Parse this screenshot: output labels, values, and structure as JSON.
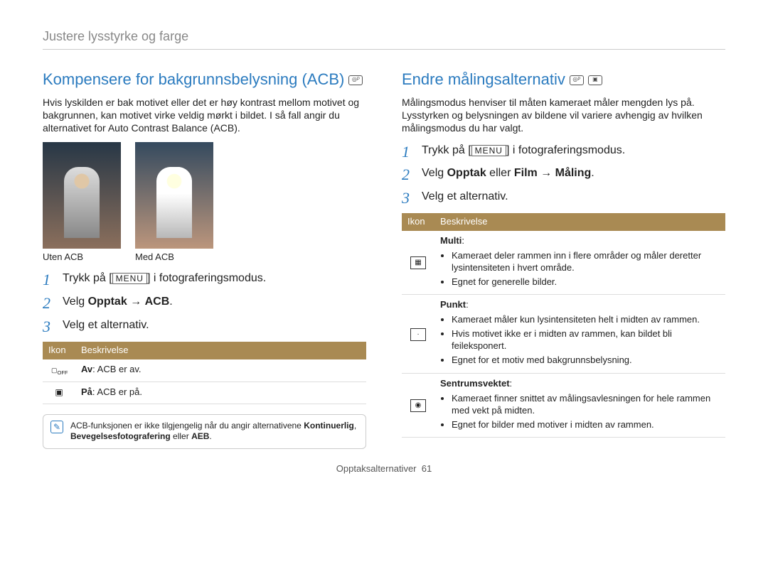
{
  "breadcrumb": "Justere lysstyrke og farge",
  "left": {
    "title": "Kompensere for bakgrunnsbelysning (ACB)",
    "mode_icons": [
      "camera-p"
    ],
    "intro": "Hvis lyskilden er bak motivet eller det er høy kontrast mellom motivet og bakgrunnen, kan motivet virke veldig mørkt i bildet. I så fall angir du alternativet for Auto Contrast Balance (ACB).",
    "captions": {
      "without": "Uten ACB",
      "with": "Med ACB"
    },
    "steps": {
      "s1_pre": "Trykk på [",
      "s1_btn": "MENU",
      "s1_post": "] i fotograferingsmodus.",
      "s2_pre": "Velg ",
      "s2_b1": "Opptak",
      "s2_arrow": " → ",
      "s2_b2": "ACB",
      "s2_post": ".",
      "s3": "Velg et alternativ."
    },
    "table": {
      "h1": "Ikon",
      "h2": "Beskrivelse",
      "rows": [
        {
          "icon": "acb-off",
          "label_b": "Av",
          "label_rest": ": ACB er av."
        },
        {
          "icon": "acb-on",
          "label_b": "På",
          "label_rest": ": ACB er på."
        }
      ]
    },
    "note": {
      "pre": "ACB-funksjonen er ikke tilgjengelig når du angir alternativene ",
      "b1": "Kontinuerlig",
      "mid": ", ",
      "b2": "Bevegelsesfotografering",
      "mid2": " eller ",
      "b3": "AEB",
      "post": "."
    }
  },
  "right": {
    "title": "Endre målingsalternativ",
    "mode_icons": [
      "camera-p",
      "video"
    ],
    "intro": "Målingsmodus henviser til måten kameraet måler mengden lys på. Lysstyrken og belysningen av bildene vil variere avhengig av hvilken målingsmodus du har valgt.",
    "steps": {
      "s1_pre": "Trykk på [",
      "s1_btn": "MENU",
      "s1_post": "] i fotograferingsmodus.",
      "s2_pre": "Velg ",
      "s2_b1": "Opptak",
      "s2_mid": " eller ",
      "s2_b2": "Film",
      "s2_arrow": " → ",
      "s2_b3": "Måling",
      "s2_post": ".",
      "s3": "Velg et alternativ."
    },
    "table": {
      "h1": "Ikon",
      "h2": "Beskrivelse",
      "rows": [
        {
          "icon": "meter-multi",
          "title": "Multi",
          "bullets": [
            "Kameraet deler rammen inn i flere områder og måler deretter lysintensiteten i hvert område.",
            "Egnet for generelle bilder."
          ]
        },
        {
          "icon": "meter-spot",
          "title": "Punkt",
          "bullets": [
            "Kameraet måler kun lysintensiteten helt i midten av rammen.",
            "Hvis motivet ikke er i midten av rammen, kan bildet bli feileksponert.",
            "Egnet for et motiv med bakgrunnsbelysning."
          ]
        },
        {
          "icon": "meter-center",
          "title": "Sentrumsvektet",
          "bullets": [
            "Kameraet finner snittet av målingsavlesningen for hele rammen med vekt på midten.",
            "Egnet for bilder med motiver i midten av rammen."
          ]
        }
      ]
    }
  },
  "footer": {
    "section": "Opptaksalternativer",
    "page": "61"
  }
}
